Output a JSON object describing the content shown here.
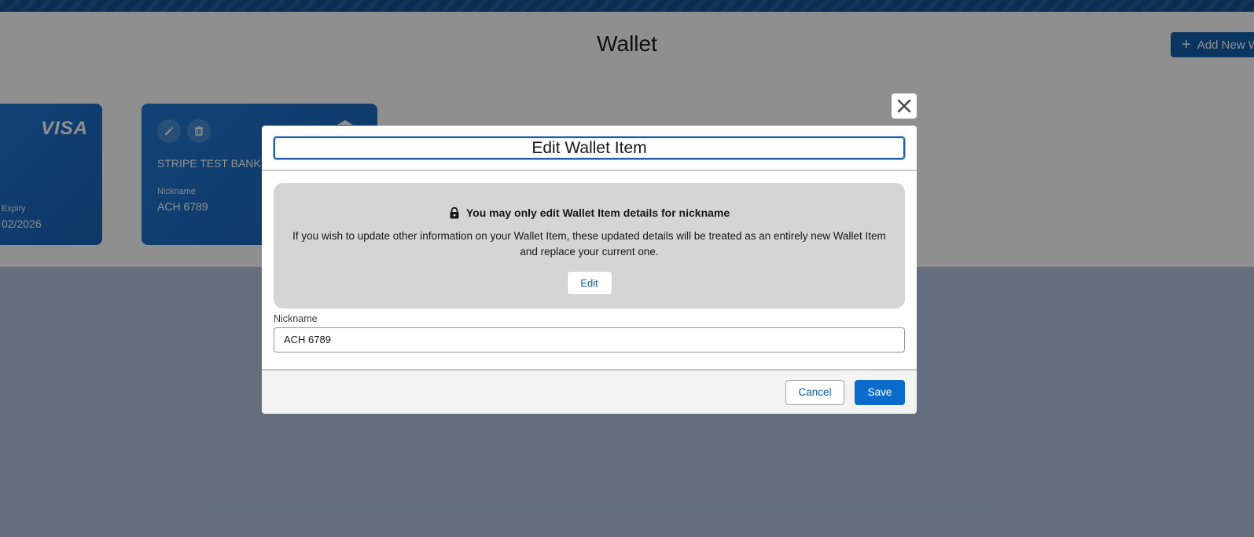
{
  "page": {
    "title": "Wallet",
    "add_button_label": "Add New W",
    "add_icon": "plus-icon"
  },
  "cards": {
    "visa": {
      "brand": "VISA",
      "expiry_label": "Expiry",
      "expiry_value": "02/2026"
    },
    "bank": {
      "name": "STRIPE TEST BANK **",
      "nickname_label": "Nickname",
      "nickname_value": "ACH 6789",
      "edit_icon": "pencil-icon",
      "delete_icon": "trash-icon"
    }
  },
  "modal": {
    "close_icon": "close-icon",
    "title": "Edit Wallet Item",
    "notice": {
      "icon": "lock-icon",
      "heading": "You may only edit Wallet Item details for nickname",
      "text": "If you wish to update other information on your Wallet Item, these updated details will be treated as an entirely new Wallet Item and replace your current one.",
      "edit_label": "Edit"
    },
    "nickname": {
      "label": "Nickname",
      "value": "ACH 6789"
    },
    "footer": {
      "cancel_label": "Cancel",
      "save_label": "Save"
    }
  },
  "colors": {
    "brand_blue": "#0b5cab",
    "card_blue": "#1b74d1",
    "notice_bg": "#d5d5d5"
  }
}
